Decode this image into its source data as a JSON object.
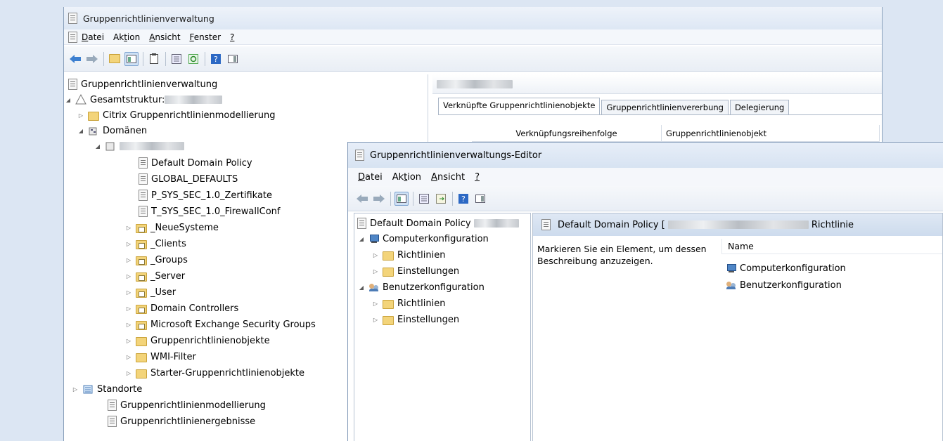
{
  "main_window": {
    "title": "Gruppenrichtlinienverwaltung",
    "menu": [
      {
        "prefix": "",
        "mnemonic": "D",
        "rest": "atei"
      },
      {
        "prefix": "Ak",
        "mnemonic": "t",
        "rest": "ion"
      },
      {
        "prefix": "",
        "mnemonic": "A",
        "rest": "nsicht"
      },
      {
        "prefix": "",
        "mnemonic": "F",
        "rest": "enster"
      },
      {
        "prefix": "",
        "mnemonic": "?",
        "rest": ""
      }
    ],
    "tree": {
      "root": "Gruppenrichtlinienverwaltung",
      "forest": "Gesamtstruktur: ",
      "citrix": "Citrix Gruppenrichtlinienmodellierung",
      "domains": "Domänen",
      "gpo_links": [
        "Default Domain Policy",
        "GLOBAL_DEFAULTS",
        "P_SYS_SEC_1.0_Zertifikate",
        "T_SYS_SEC_1.0_FirewallConf"
      ],
      "ous": [
        "_NeueSysteme",
        "_Clients",
        "_Groups",
        "_Server",
        "_User",
        "Domain Controllers",
        "Microsoft Exchange Security Groups"
      ],
      "gpo_container": "Gruppenrichtlinienobjekte",
      "wmi": "WMI-Filter",
      "starter": "Starter-Gruppenrichtlinienobjekte",
      "sites": "Standorte",
      "modeling": "Gruppenrichtlinienmodellierung",
      "results": "Gruppenrichtlinienergebnisse"
    },
    "right": {
      "tabs": [
        "Verknüpfte Gruppenrichtlinienobjekte",
        "Gruppenrichtlinienvererbung",
        "Delegierung"
      ],
      "columns": [
        "Verknüpfungsreihenfolge",
        "Gruppenrichtlinienobjekt"
      ]
    }
  },
  "editor_window": {
    "title": "Gruppenrichtlinienverwaltungs-Editor",
    "menu": [
      {
        "prefix": "",
        "mnemonic": "D",
        "rest": "atei"
      },
      {
        "prefix": "Ak",
        "mnemonic": "t",
        "rest": "ion"
      },
      {
        "prefix": "",
        "mnemonic": "A",
        "rest": "nsicht"
      },
      {
        "prefix": "",
        "mnemonic": "?",
        "rest": ""
      }
    ],
    "tree": {
      "root": "Default Domain Policy",
      "computer": "Computerkonfiguration",
      "user": "Benutzerkonfiguration",
      "policies": "Richtlinien",
      "settings": "Einstellungen"
    },
    "right": {
      "header_prefix": "Default Domain Policy [",
      "header_suffix": "Richtlinie",
      "description": "Markieren Sie ein Element, um dessen Beschreibung anzuzeigen.",
      "name_column": "Name",
      "items": [
        "Computerkonfiguration",
        "Benutzerkonfiguration"
      ]
    }
  }
}
